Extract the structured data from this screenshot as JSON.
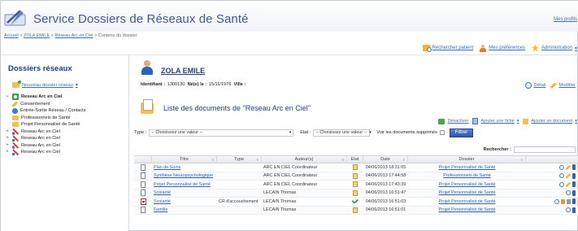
{
  "header": {
    "app_title": "Service Dossiers de Réseaux de Santé",
    "logout_label": "Mes profils"
  },
  "breadcrumb": {
    "home": "Accueil",
    "patient": "ZOLA EMILE",
    "network": "Réseau Arc en Ciel",
    "current": "Contenu du dossier"
  },
  "topbar": {
    "search_patient": "Rechercher patient",
    "preferences": "Mes préférences",
    "admin": "Administration"
  },
  "sidebar": {
    "title": "Dossiers réseaux",
    "new_folder": "Nouveau dossier réseau",
    "items": [
      {
        "label": "Reseau Arc en Ciel",
        "status": "active",
        "expanded": true
      },
      {
        "label": "Consentement"
      },
      {
        "label": "Entrée-Sortie Réseau / Contacts"
      },
      {
        "label": "Professionnels de Santé"
      },
      {
        "label": "Projet Personnalisé de Santé"
      },
      {
        "label": "Reseau Arc en Ciel",
        "status": "closed"
      },
      {
        "label": "Reseau Arc en Ciel",
        "status": "closed"
      },
      {
        "label": "Reseau Arc en Ciel",
        "status": "closed"
      },
      {
        "label": "Reseau Arc en Ciel",
        "status": "closed"
      }
    ]
  },
  "patient": {
    "name": "ZOLA EMILE",
    "id_label": "Identifiant :",
    "id_value": "1300130",
    "birth_label": "Né(e) le :",
    "birth_value": "15/11/1976",
    "city_label": "Ville :",
    "city_value": "",
    "detail_label": "Détail",
    "edit_label": "Modifier"
  },
  "documents": {
    "title": "Liste des documents de \"Reseau Arc en Ciel\"",
    "actions": {
      "unfollow": "Désactiver",
      "add_file": "Ajouter une fiche",
      "add_document": "Ajouter un document"
    },
    "filters": {
      "type_label": "Type :",
      "type_value": "-- Choisissez une valeur --",
      "state_label": "Etat :",
      "state_value": "-- Choisissez une valeur --",
      "show_deleted_label": "Voir les documents supprimés",
      "filter_button": "Filtrer",
      "search_label": "Rechercher :"
    },
    "columns": [
      "",
      "Titre",
      "Type",
      "Auteur(s)",
      "Etat",
      "Date",
      "Dossier",
      ""
    ],
    "rows": [
      {
        "file_icon": "doc-icon",
        "title": "Plan de Soins",
        "type": "",
        "author": "ARC EN CIEL Coordinateur",
        "state_icon": "draft-icon",
        "date": "04/06/2013 18:31:05",
        "folder": "Projet Personnalisé de Santé"
      },
      {
        "file_icon": "doc-icon",
        "title": "Synthèse Neuropsychologique",
        "type": "",
        "author": "ARC EN CIEL Coordinateur",
        "state_icon": "draft-icon",
        "date": "04/06/2013 17:44:58",
        "folder": "Professionnels de Santé"
      },
      {
        "file_icon": "doc-icon",
        "title": "Projet Personnalisé de Santé",
        "type": "",
        "author": "ARC EN CIEL Coordinateur",
        "state_icon": "draft-icon",
        "date": "04/06/2013 17:43:39",
        "folder": "Projet Personnalisé de Santé"
      },
      {
        "file_icon": "doc-icon",
        "title": "Scolarité",
        "type": "",
        "author": "LECAIN Thomas",
        "state_icon": "draft-icon",
        "date": "04/06/2013 16:51:47",
        "folder": "Projet Personnalisé de Santé"
      },
      {
        "file_icon": "pdf-icon",
        "title": "Scolarité",
        "type": "CR d'accouchement",
        "author": "LECAIN Thomas",
        "state_icon": "validated-icon",
        "date": "04/06/2013 16:51:03",
        "folder": "Projet Personnalisé de Santé"
      },
      {
        "file_icon": "doc-icon",
        "title": "Famille",
        "type": "",
        "author": "LECAIN Thomas",
        "state_icon": "draft-icon",
        "date": "04/06/2013 16:51:01",
        "folder": "Projet Personnalisé de Santé"
      }
    ]
  },
  "colors": {
    "title_blue": "#3c5a9a",
    "link_blue": "#2a5fb0",
    "heading_navy": "#1d3f8a",
    "filter_button": "#2c55b0"
  }
}
